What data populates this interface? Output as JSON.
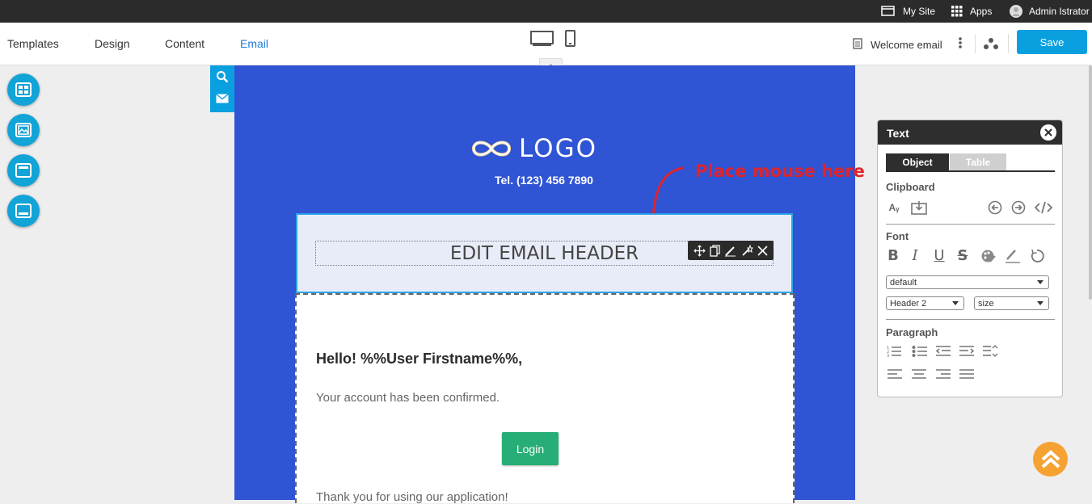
{
  "adminbar": {
    "mysite_label": "My Site",
    "apps_label": "Apps",
    "user_label": "Admin Istrator"
  },
  "toolbar": {
    "tabs": [
      {
        "label": "Templates"
      },
      {
        "label": "Design"
      },
      {
        "label": "Content"
      },
      {
        "label": "Email",
        "active": true
      }
    ],
    "doc_label": "Welcome email",
    "save_label": "Save"
  },
  "email": {
    "logo_text": "LOGO",
    "phone": "Tel. (123) 456 7890",
    "header_text": "EDIT EMAIL HEADER",
    "greeting": "Hello! %%User Firstname%%,",
    "body_text": "Your account has been confirmed.",
    "login_label": "Login",
    "closing_text": "Thank you for using our application!"
  },
  "annotation": {
    "text": "Place mouse here"
  },
  "panel": {
    "title": "Text",
    "tabs": [
      {
        "label": "Object",
        "active": true
      },
      {
        "label": "Table"
      }
    ],
    "clipboard_label": "Clipboard",
    "font_label": "Font",
    "font_family_value": "default",
    "format_value": "Header 2",
    "size_value": "size",
    "paragraph_label": "Paragraph"
  },
  "colors": {
    "accent": "#0aa0e0",
    "canvas_blue": "#2f54d4",
    "login_green": "#27ae76",
    "annotation_red": "#e0242b",
    "scrolltop_orange": "#f5a233"
  }
}
